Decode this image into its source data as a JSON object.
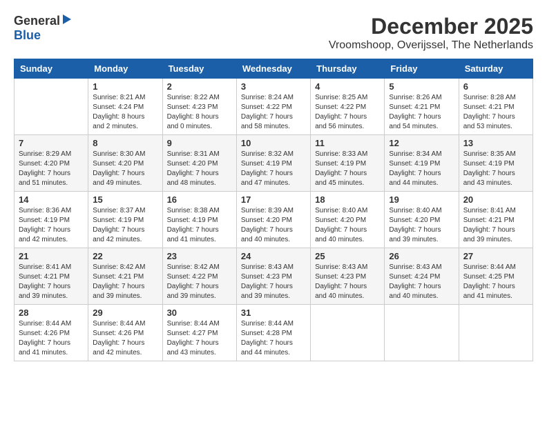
{
  "header": {
    "logo_general": "General",
    "logo_blue": "Blue",
    "month": "December 2025",
    "location": "Vroomshoop, Overijssel, The Netherlands"
  },
  "weekdays": [
    "Sunday",
    "Monday",
    "Tuesday",
    "Wednesday",
    "Thursday",
    "Friday",
    "Saturday"
  ],
  "weeks": [
    [
      {
        "day": "",
        "info": ""
      },
      {
        "day": "1",
        "info": "Sunrise: 8:21 AM\nSunset: 4:24 PM\nDaylight: 8 hours\nand 2 minutes."
      },
      {
        "day": "2",
        "info": "Sunrise: 8:22 AM\nSunset: 4:23 PM\nDaylight: 8 hours\nand 0 minutes."
      },
      {
        "day": "3",
        "info": "Sunrise: 8:24 AM\nSunset: 4:22 PM\nDaylight: 7 hours\nand 58 minutes."
      },
      {
        "day": "4",
        "info": "Sunrise: 8:25 AM\nSunset: 4:22 PM\nDaylight: 7 hours\nand 56 minutes."
      },
      {
        "day": "5",
        "info": "Sunrise: 8:26 AM\nSunset: 4:21 PM\nDaylight: 7 hours\nand 54 minutes."
      },
      {
        "day": "6",
        "info": "Sunrise: 8:28 AM\nSunset: 4:21 PM\nDaylight: 7 hours\nand 53 minutes."
      }
    ],
    [
      {
        "day": "7",
        "info": "Sunrise: 8:29 AM\nSunset: 4:20 PM\nDaylight: 7 hours\nand 51 minutes."
      },
      {
        "day": "8",
        "info": "Sunrise: 8:30 AM\nSunset: 4:20 PM\nDaylight: 7 hours\nand 49 minutes."
      },
      {
        "day": "9",
        "info": "Sunrise: 8:31 AM\nSunset: 4:20 PM\nDaylight: 7 hours\nand 48 minutes."
      },
      {
        "day": "10",
        "info": "Sunrise: 8:32 AM\nSunset: 4:19 PM\nDaylight: 7 hours\nand 47 minutes."
      },
      {
        "day": "11",
        "info": "Sunrise: 8:33 AM\nSunset: 4:19 PM\nDaylight: 7 hours\nand 45 minutes."
      },
      {
        "day": "12",
        "info": "Sunrise: 8:34 AM\nSunset: 4:19 PM\nDaylight: 7 hours\nand 44 minutes."
      },
      {
        "day": "13",
        "info": "Sunrise: 8:35 AM\nSunset: 4:19 PM\nDaylight: 7 hours\nand 43 minutes."
      }
    ],
    [
      {
        "day": "14",
        "info": "Sunrise: 8:36 AM\nSunset: 4:19 PM\nDaylight: 7 hours\nand 42 minutes."
      },
      {
        "day": "15",
        "info": "Sunrise: 8:37 AM\nSunset: 4:19 PM\nDaylight: 7 hours\nand 42 minutes."
      },
      {
        "day": "16",
        "info": "Sunrise: 8:38 AM\nSunset: 4:19 PM\nDaylight: 7 hours\nand 41 minutes."
      },
      {
        "day": "17",
        "info": "Sunrise: 8:39 AM\nSunset: 4:20 PM\nDaylight: 7 hours\nand 40 minutes."
      },
      {
        "day": "18",
        "info": "Sunrise: 8:40 AM\nSunset: 4:20 PM\nDaylight: 7 hours\nand 40 minutes."
      },
      {
        "day": "19",
        "info": "Sunrise: 8:40 AM\nSunset: 4:20 PM\nDaylight: 7 hours\nand 39 minutes."
      },
      {
        "day": "20",
        "info": "Sunrise: 8:41 AM\nSunset: 4:21 PM\nDaylight: 7 hours\nand 39 minutes."
      }
    ],
    [
      {
        "day": "21",
        "info": "Sunrise: 8:41 AM\nSunset: 4:21 PM\nDaylight: 7 hours\nand 39 minutes."
      },
      {
        "day": "22",
        "info": "Sunrise: 8:42 AM\nSunset: 4:21 PM\nDaylight: 7 hours\nand 39 minutes."
      },
      {
        "day": "23",
        "info": "Sunrise: 8:42 AM\nSunset: 4:22 PM\nDaylight: 7 hours\nand 39 minutes."
      },
      {
        "day": "24",
        "info": "Sunrise: 8:43 AM\nSunset: 4:23 PM\nDaylight: 7 hours\nand 39 minutes."
      },
      {
        "day": "25",
        "info": "Sunrise: 8:43 AM\nSunset: 4:23 PM\nDaylight: 7 hours\nand 40 minutes."
      },
      {
        "day": "26",
        "info": "Sunrise: 8:43 AM\nSunset: 4:24 PM\nDaylight: 7 hours\nand 40 minutes."
      },
      {
        "day": "27",
        "info": "Sunrise: 8:44 AM\nSunset: 4:25 PM\nDaylight: 7 hours\nand 41 minutes."
      }
    ],
    [
      {
        "day": "28",
        "info": "Sunrise: 8:44 AM\nSunset: 4:26 PM\nDaylight: 7 hours\nand 41 minutes."
      },
      {
        "day": "29",
        "info": "Sunrise: 8:44 AM\nSunset: 4:26 PM\nDaylight: 7 hours\nand 42 minutes."
      },
      {
        "day": "30",
        "info": "Sunrise: 8:44 AM\nSunset: 4:27 PM\nDaylight: 7 hours\nand 43 minutes."
      },
      {
        "day": "31",
        "info": "Sunrise: 8:44 AM\nSunset: 4:28 PM\nDaylight: 7 hours\nand 44 minutes."
      },
      {
        "day": "",
        "info": ""
      },
      {
        "day": "",
        "info": ""
      },
      {
        "day": "",
        "info": ""
      }
    ]
  ]
}
